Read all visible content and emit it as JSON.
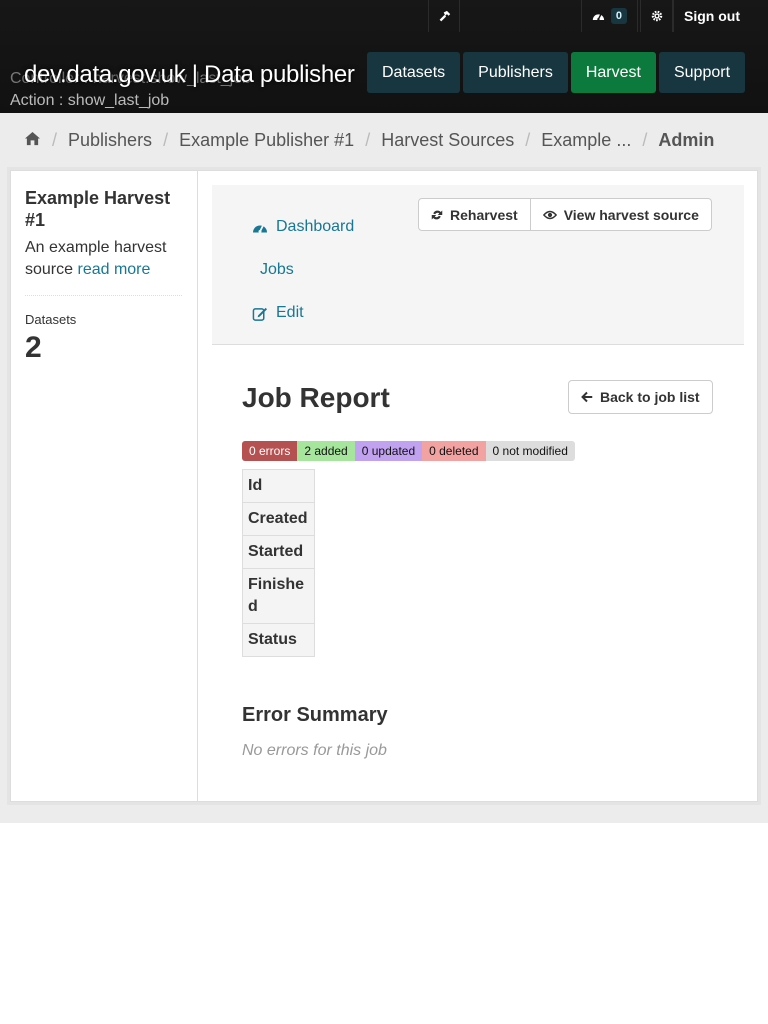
{
  "account": {
    "sysadmin_icon": "hammer-icon",
    "dashboard_icon": "dashboard-icon",
    "dashboard_count": "0",
    "settings_icon": "gear-icon",
    "signout_label": "Sign out"
  },
  "debug": {
    "controller": "Controller : harvest.show_last_job",
    "action": "Action : show_last_job"
  },
  "site": {
    "title": "dev.data.gov.uk | Data publisher"
  },
  "nav": {
    "items": [
      {
        "label": "Datasets"
      },
      {
        "label": "Publishers"
      },
      {
        "label": "Harvest"
      },
      {
        "label": "Support"
      }
    ],
    "active_color": "#0c7a3c"
  },
  "breadcrumb": {
    "home_icon": "home-icon",
    "items": [
      "Publishers",
      "Example Publisher #1",
      "Harvest Sources",
      "Example ...",
      "Admin"
    ]
  },
  "sidebar": {
    "title": "Example Harvest #1",
    "description": "An example harvest source",
    "read_more": "read more",
    "stat_label": "Datasets",
    "stat_value": "2"
  },
  "actions": {
    "dashboard": "Dashboard",
    "jobs": "Jobs",
    "edit": "Edit",
    "reharvest": "Reharvest",
    "view_source": "View harvest source"
  },
  "report": {
    "title": "Job Report",
    "back_label": "Back to job list",
    "badges": {
      "errors": "0 errors",
      "added": "2 added",
      "updated": "0 updated",
      "deleted": "0 deleted",
      "not_modified": "0 not modified"
    },
    "table_headers": [
      "Id",
      "Created",
      "Started",
      "Finished",
      "Status"
    ],
    "error_summary_title": "Error Summary",
    "no_errors_text": "No errors for this job"
  }
}
